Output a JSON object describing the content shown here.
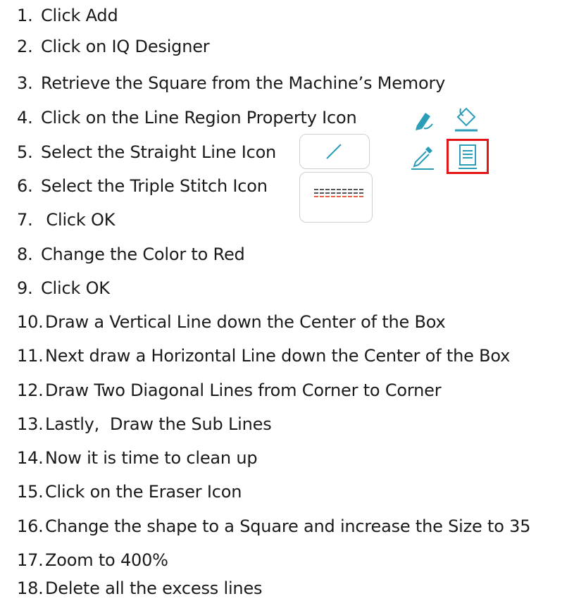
{
  "steps": [
    {
      "num": "1.",
      "text": "Click Add"
    },
    {
      "num": "2.",
      "text": "Click on IQ Designer"
    },
    {
      "num": "3.",
      "text": "Retrieve the Square from the Machine’s Memory"
    },
    {
      "num": "4.",
      "text": "Click on the Line Region Property Icon"
    },
    {
      "num": "5.",
      "text": "Select the Straight Line Icon"
    },
    {
      "num": "6.",
      "text": "Select the Triple Stitch Icon"
    },
    {
      "num": "7.",
      "text": " Click OK"
    },
    {
      "num": "8.",
      "text": "Change the Color to Red"
    },
    {
      "num": "9.",
      "text": "Click OK"
    },
    {
      "num": "10.",
      "text": "Draw a Vertical Line down the Center of the Box"
    },
    {
      "num": "11.",
      "text": "Next draw a Horizontal Line down the Center of the Box"
    },
    {
      "num": "12.",
      "text": "Draw Two Diagonal Lines from Corner to Corner"
    },
    {
      "num": "13.",
      "text": "Lastly,  Draw the Sub Lines"
    },
    {
      "num": "14.",
      "text": "Now it is time to clean up"
    },
    {
      "num": "15.",
      "text": "Click on the Eraser Icon"
    },
    {
      "num": "16.",
      "text": "Change the shape to a Square and increase the Size to 35"
    },
    {
      "num": "17.",
      "text": "Zoom to 400%"
    },
    {
      "num": "18.",
      "text": "Delete all the excess lines"
    }
  ],
  "icons": {
    "palette": [
      "pen-icon",
      "fill-bucket-icon",
      "eyedropper-icon",
      "line-region-property-icon"
    ],
    "straight_line": "straight-line-icon",
    "triple_stitch": "triple-stitch-icon"
  },
  "colors": {
    "teal": "#2a9db8",
    "red": "#e0161b"
  }
}
